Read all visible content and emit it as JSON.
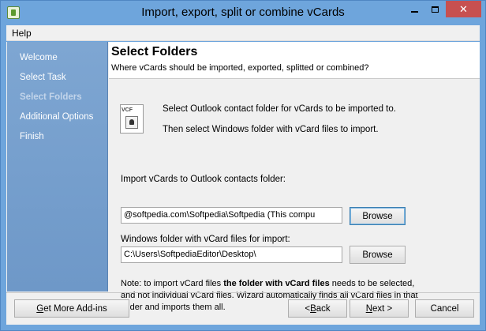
{
  "window": {
    "title": "Import, export, split or combine vCards",
    "close_glyph": "✕"
  },
  "menu": {
    "help": "Help"
  },
  "sidebar": {
    "items": [
      {
        "label": "Welcome"
      },
      {
        "label": "Select Task"
      },
      {
        "label": "Select Folders",
        "active": true
      },
      {
        "label": "Additional Options"
      },
      {
        "label": "Finish"
      }
    ]
  },
  "header": {
    "title": "Select Folders",
    "subtitle": "Where vCards should be imported, exported, splitted or combined?"
  },
  "main": {
    "icon_label": "VCF",
    "info_line1": "Select Outlook contact folder for vCards to be imported to.",
    "info_line2": "Then select Windows folder with vCard files to import.",
    "outlook_label": "Import vCards to Outlook contacts folder:",
    "outlook_value": "@softpedia.com\\Softpedia\\Softpedia (This compu",
    "outlook_browse": "Browse",
    "windows_label": "Windows folder with vCard files for import:",
    "windows_value": "C:\\Users\\SoftpediaEditor\\Desktop\\",
    "windows_browse": "Browse",
    "note_prefix": "Note: to import vCard files ",
    "note_bold": "the folder with vCard files",
    "note_suffix": " needs to be selected, and not individual vCard files. Wizard automatically finds all vCard files in that folder and imports them all."
  },
  "footer": {
    "addins_pre": "",
    "addins_u": "G",
    "addins_post": "et More Add-ins",
    "back_pre": "< ",
    "back_u": "B",
    "back_post": "ack",
    "next_u": "N",
    "next_post": "ext >",
    "cancel": "Cancel"
  }
}
